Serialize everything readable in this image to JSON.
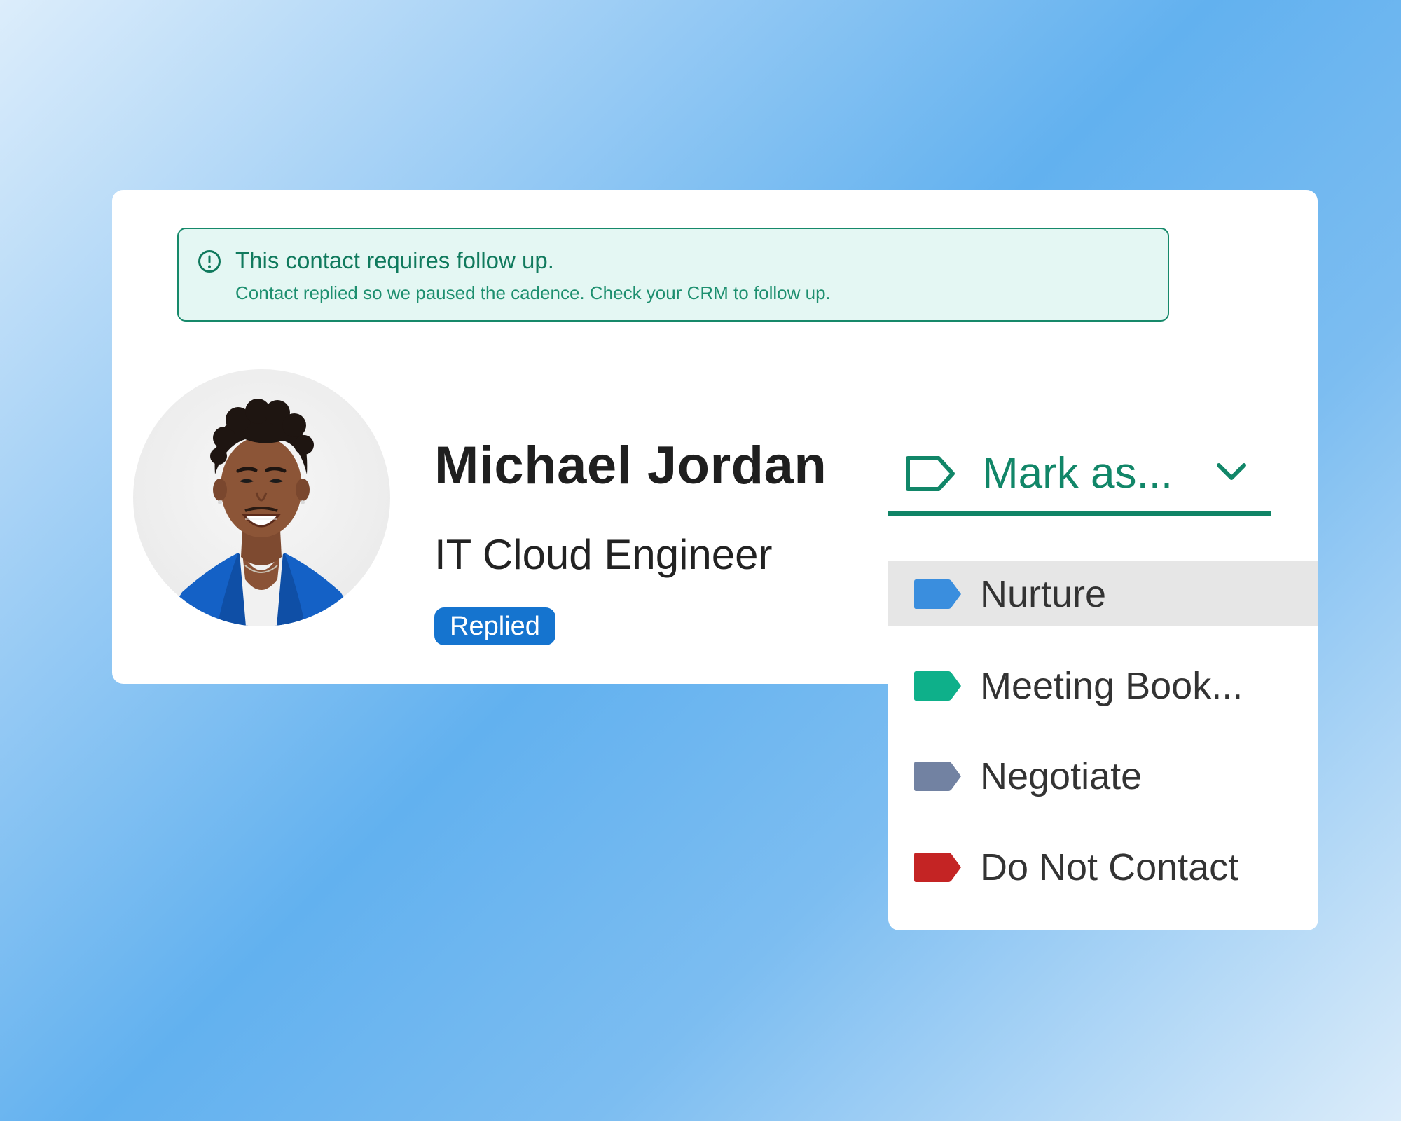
{
  "alert": {
    "icon": "alert-circle-icon",
    "title": "This contact requires follow up.",
    "subtitle": "Contact replied so we paused the cadence. Check your CRM to follow up."
  },
  "contact": {
    "name": "Michael Jordan",
    "job_title": "IT Cloud Engineer",
    "status_badge": "Replied"
  },
  "mark_as": {
    "label": "Mark as...",
    "icon": "tag-outline-icon",
    "chevron": "chevron-down-icon",
    "options": [
      {
        "label": "Nurture",
        "color": "#3a8ede",
        "highlighted": true
      },
      {
        "label": "Meeting Book...",
        "color": "#0eb08a",
        "highlighted": false
      },
      {
        "label": "Negotiate",
        "color": "#7282a2",
        "highlighted": false
      },
      {
        "label": "Do Not Contact",
        "color": "#c42424",
        "highlighted": false
      }
    ]
  },
  "colors": {
    "accent_green": "#118668",
    "alert_bg": "#e4f7f3",
    "badge_blue": "#1574cf"
  }
}
